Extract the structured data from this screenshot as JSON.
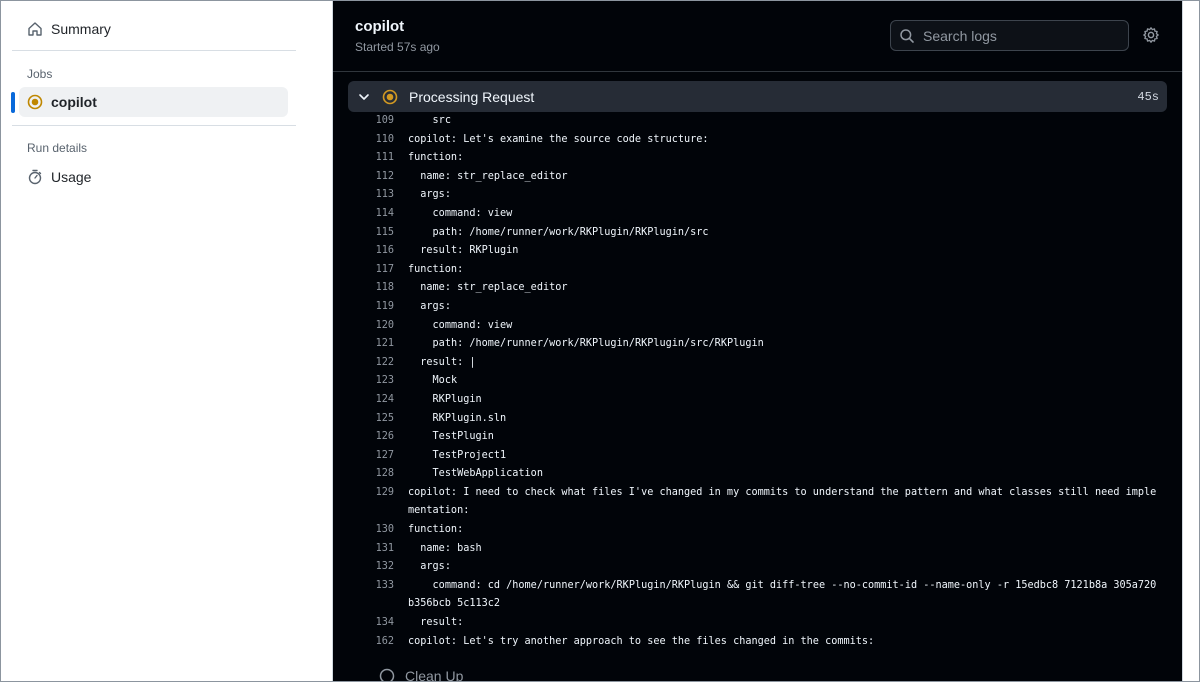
{
  "sidebar": {
    "summary_label": "Summary",
    "jobs_heading": "Jobs",
    "job_label": "copilot",
    "run_details_heading": "Run details",
    "usage_label": "Usage"
  },
  "header": {
    "title": "copilot",
    "subtitle": "Started 57s ago",
    "search_placeholder": "Search logs"
  },
  "step": {
    "title": "Processing Request",
    "duration": "45s",
    "status_color": "#d29922"
  },
  "log_lines": [
    {
      "n": "109",
      "t": "    src"
    },
    {
      "n": "110",
      "t": "copilot: Let's examine the source code structure:"
    },
    {
      "n": "111",
      "t": "function:"
    },
    {
      "n": "112",
      "t": "  name: str_replace_editor"
    },
    {
      "n": "113",
      "t": "  args:"
    },
    {
      "n": "114",
      "t": "    command: view"
    },
    {
      "n": "115",
      "t": "    path: /home/runner/work/RKPlugin/RKPlugin/src"
    },
    {
      "n": "116",
      "t": "  result: RKPlugin"
    },
    {
      "n": "117",
      "t": "function:"
    },
    {
      "n": "118",
      "t": "  name: str_replace_editor"
    },
    {
      "n": "119",
      "t": "  args:"
    },
    {
      "n": "120",
      "t": "    command: view"
    },
    {
      "n": "121",
      "t": "    path: /home/runner/work/RKPlugin/RKPlugin/src/RKPlugin"
    },
    {
      "n": "122",
      "t": "  result: |"
    },
    {
      "n": "123",
      "t": "    Mock"
    },
    {
      "n": "124",
      "t": "    RKPlugin"
    },
    {
      "n": "125",
      "t": "    RKPlugin.sln"
    },
    {
      "n": "126",
      "t": "    TestPlugin"
    },
    {
      "n": "127",
      "t": "    TestProject1"
    },
    {
      "n": "128",
      "t": "    TestWebApplication"
    },
    {
      "n": "129",
      "t": "copilot: I need to check what files I've changed in my commits to understand the pattern and what classes still need implementation:"
    },
    {
      "n": "130",
      "t": "function:"
    },
    {
      "n": "131",
      "t": "  name: bash"
    },
    {
      "n": "132",
      "t": "  args:"
    },
    {
      "n": "133",
      "t": "    command: cd /home/runner/work/RKPlugin/RKPlugin && git diff-tree --no-commit-id --name-only -r 15edbc8 7121b8a 305a720b356bcb 5c113c2"
    },
    {
      "n": "134",
      "t": "  result:"
    },
    {
      "n": "162",
      "t": "copilot: Let's try another approach to see the files changed in the commits:"
    }
  ],
  "cleanup_label": "Clean Up"
}
